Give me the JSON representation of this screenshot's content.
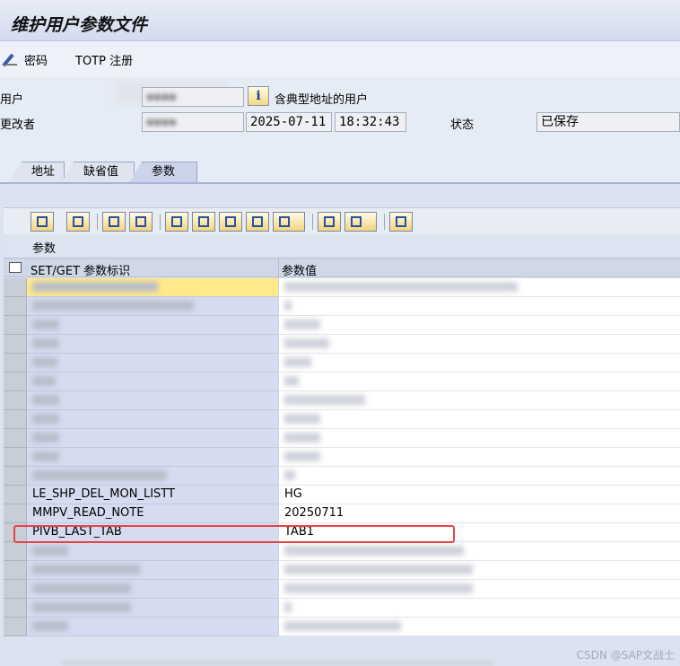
{
  "window": {
    "title": "维护用户参数文件"
  },
  "toolbar": {
    "password_label": "密码",
    "totp_label": "TOTP 注册"
  },
  "form": {
    "user_label": "用户",
    "user_value": "▪▪▪▪",
    "changed_by_label": "更改者",
    "changed_by_value": "▪▪▪▪",
    "info_text": "含典型地址的用户",
    "date": "2025-07-11",
    "time": "18:32:43",
    "status_label": "状态",
    "status_value": "已保存"
  },
  "tabs": [
    {
      "label": "地址",
      "active": false
    },
    {
      "label": "缺省值",
      "active": false
    },
    {
      "label": "参数",
      "active": true
    }
  ],
  "grid": {
    "caption": "参数",
    "columns": [
      "SET/GET 参数标识",
      "参数值"
    ],
    "rows": [
      {
        "id": "",
        "value": "",
        "blurred": true
      },
      {
        "id": "",
        "value": "",
        "blurred": true
      },
      {
        "id": "",
        "value": "",
        "blurred": true
      },
      {
        "id": "",
        "value": "",
        "blurred": true
      },
      {
        "id": "",
        "value": "",
        "blurred": true
      },
      {
        "id": "",
        "value": "",
        "blurred": true
      },
      {
        "id": "",
        "value": "",
        "blurred": true
      },
      {
        "id": "",
        "value": "",
        "blurred": true
      },
      {
        "id": "",
        "value": "",
        "blurred": true
      },
      {
        "id": "",
        "value": "",
        "blurred": true
      },
      {
        "id": "",
        "value": "",
        "blurred": true
      },
      {
        "id": "LE_SHP_DEL_MON_LISTT",
        "value": "HG",
        "blurred": false
      },
      {
        "id": "MMPV_READ_NOTE",
        "value": "20250711",
        "blurred": false,
        "highlighted": true
      },
      {
        "id": "PIVB_LAST_TAB",
        "value": "TAB1",
        "blurred": false
      },
      {
        "id": "",
        "value": "",
        "blurred": true
      },
      {
        "id": "",
        "value": "",
        "blurred": true
      },
      {
        "id": "",
        "value": "",
        "blurred": true
      },
      {
        "id": "",
        "value": "",
        "blurred": true
      },
      {
        "id": "",
        "value": "",
        "blurred": true
      }
    ]
  },
  "watermark": "CSDN @SAP文战士",
  "colors": {
    "highlight_border": "#e34448",
    "key_column": "#d6dcf0",
    "title_bg": "#d3dbee"
  }
}
